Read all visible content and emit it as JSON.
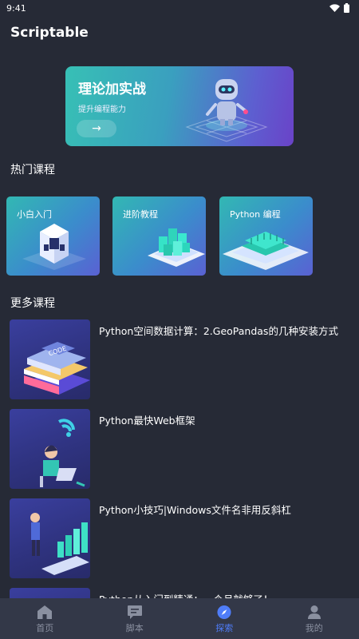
{
  "status_bar": {
    "time": "9:41",
    "icons": [
      "wifi-icon",
      "battery-icon"
    ]
  },
  "app": {
    "title": "Scriptable"
  },
  "banner": {
    "title": "理论加实战",
    "subtitle": "提升编程能力",
    "arrow": "→"
  },
  "hot": {
    "title": "热门课程",
    "cards": [
      {
        "label": "小白入门",
        "icon": "cube-icon"
      },
      {
        "label": "进阶教程",
        "icon": "bar-blocks-icon"
      },
      {
        "label": "Python 编程",
        "icon": "chip-icon"
      }
    ]
  },
  "more": {
    "title": "更多课程",
    "courses": [
      {
        "title": "Python空间数据计算：2.GeoPandas的几种安装方式"
      },
      {
        "title": "Python最快Web框架"
      },
      {
        "title": "Python小技巧|Windows文件名非用反斜杠"
      },
      {
        "title": "Python从入门到精通：一个月就够了！"
      }
    ]
  },
  "tabbar": {
    "tabs": [
      {
        "label": "首页",
        "icon": "home-icon"
      },
      {
        "label": "脚本",
        "icon": "script-icon"
      },
      {
        "label": "探索",
        "icon": "compass-icon",
        "active": true
      },
      {
        "label": "我的",
        "icon": "user-icon"
      }
    ]
  },
  "colors": {
    "background": "#262a36",
    "tabbar": "#333848",
    "accent": "#4f7df9",
    "inactive": "#8a90a0"
  }
}
